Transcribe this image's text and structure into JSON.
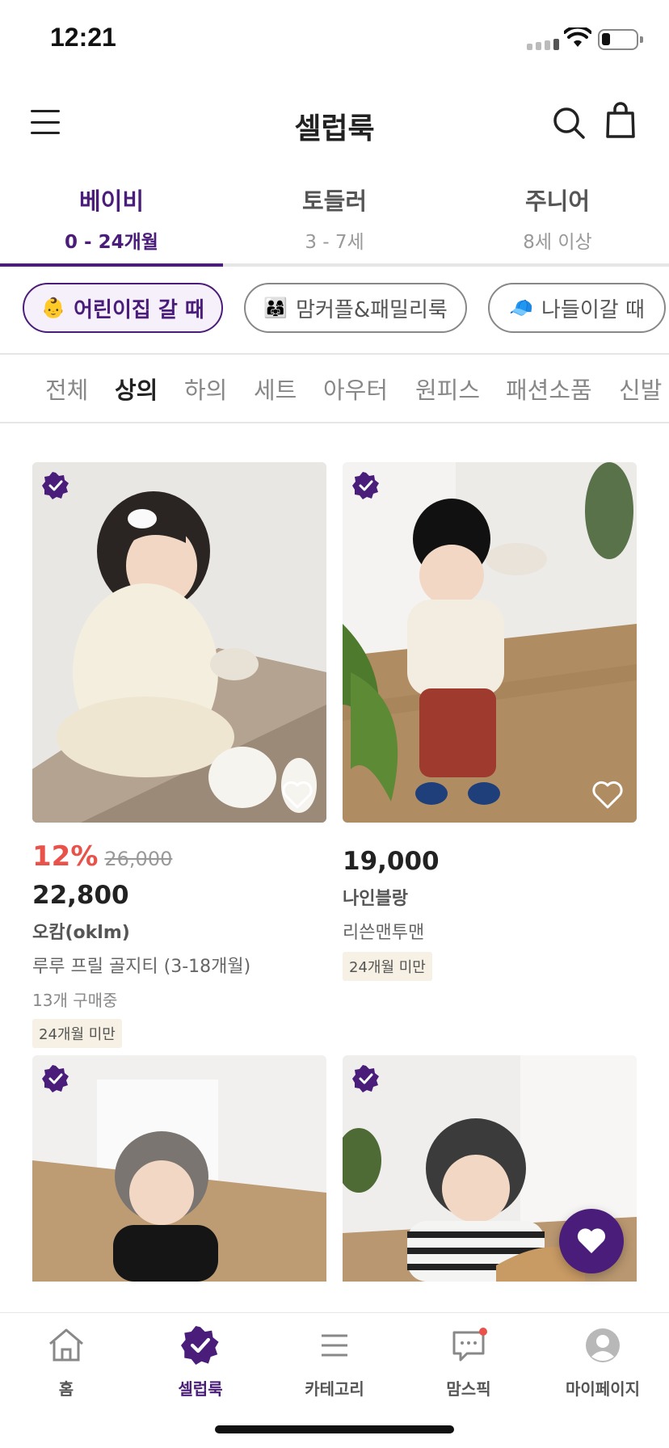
{
  "status_bar": {
    "time": "12:21"
  },
  "header": {
    "title": "셀럽룩"
  },
  "age_tabs": [
    {
      "label": "베이비",
      "sub": "0 - 24개월"
    },
    {
      "label": "토들러",
      "sub": "3 - 7세"
    },
    {
      "label": "주니어",
      "sub": "8세 이상"
    }
  ],
  "theme_chips": [
    {
      "emoji": "👶",
      "label": "어린이집 갈 때"
    },
    {
      "emoji": "👨‍👩‍👧",
      "label": "맘커플&패밀리룩"
    },
    {
      "emoji": "🧢",
      "label": "나들이갈 때"
    }
  ],
  "categories": [
    "전체",
    "상의",
    "하의",
    "세트",
    "아우터",
    "원피스",
    "패션소품",
    "신발"
  ],
  "products": [
    {
      "discount": "12%",
      "original_price": "26,000",
      "price": "22,800",
      "brand": "오캄(oklm)",
      "name": "루루 프릴 골지티 (3-18개월)",
      "buying": "13개 구매중",
      "age_tag": "24개월 미만"
    },
    {
      "price": "19,000",
      "brand": "나인블랑",
      "name": "리쓴맨투맨",
      "age_tag": "24개월 미만"
    }
  ],
  "bottom_nav": [
    {
      "label": "홈",
      "icon": "home-icon"
    },
    {
      "label": "셀럽룩",
      "icon": "celeb-check-icon"
    },
    {
      "label": "카테고리",
      "icon": "category-list-icon"
    },
    {
      "label": "맘스픽",
      "icon": "chat-bubble-icon"
    },
    {
      "label": "마이페이지",
      "icon": "user-icon"
    }
  ],
  "colors": {
    "accent": "#4a1d7a",
    "discount": "#e8524a",
    "tag_bg": "#f6f1e4"
  }
}
